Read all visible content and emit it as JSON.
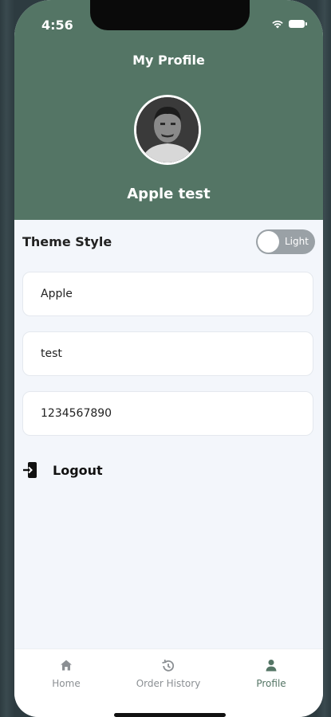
{
  "status_bar": {
    "time": "4:56"
  },
  "header": {
    "title": "My Profile",
    "user_name": "Apple test",
    "background_color": "#547565"
  },
  "theme": {
    "label": "Theme Style",
    "toggle_state": "Light"
  },
  "fields": [
    {
      "value": "Apple"
    },
    {
      "value": "test"
    },
    {
      "value": "1234567890"
    }
  ],
  "logout": {
    "label": "Logout",
    "icon": "logout-icon"
  },
  "tabbar": {
    "items": [
      {
        "label": "Home",
        "icon": "home-icon",
        "active": false
      },
      {
        "label": "Order History",
        "icon": "history-icon",
        "active": false
      },
      {
        "label": "Profile",
        "icon": "person-icon",
        "active": true
      }
    ]
  },
  "colors": {
    "accent": "#547565",
    "page_background": "#f3f6fb",
    "inactive_tab": "#8b8f93"
  }
}
